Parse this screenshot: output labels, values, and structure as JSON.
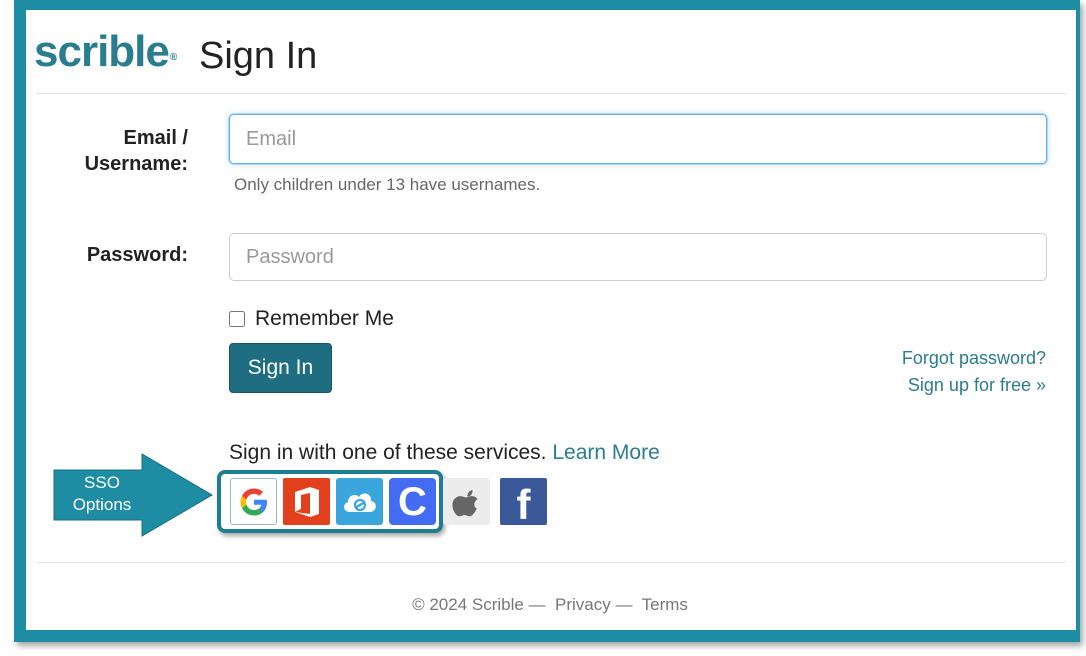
{
  "header": {
    "logo": "scrible",
    "logo_mark": "®",
    "title": "Sign In"
  },
  "form": {
    "email_label_line1": "Email /",
    "email_label_line2": "Username:",
    "email_placeholder": "Email",
    "email_help": "Only children under 13 have usernames.",
    "password_label": "Password:",
    "password_placeholder": "Password",
    "remember_label": "Remember Me",
    "submit_label": "Sign In",
    "forgot_link": "Forgot password?",
    "signup_link": "Sign up for free »"
  },
  "sso": {
    "prompt": "Sign in with one of these services.",
    "learn_more": "Learn More",
    "callout_line1": "SSO",
    "callout_line2": "Options",
    "providers": [
      "Google",
      "Office 365",
      "ClassLink",
      "Clever",
      "Apple",
      "Facebook"
    ]
  },
  "footer": {
    "copyright": "© 2024 Scrible",
    "sep1": "—",
    "privacy": "Privacy",
    "sep2": "—",
    "terms": "Terms"
  },
  "colors": {
    "frame": "#1e8ca3",
    "accent": "#2a7d8e",
    "button": "#1f6d80"
  }
}
